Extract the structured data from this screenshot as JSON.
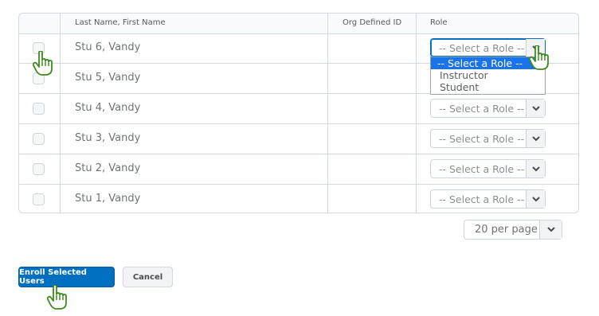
{
  "table": {
    "headers": {
      "name": "Last Name, First Name",
      "org_id": "Org Defined ID",
      "role": "Role"
    },
    "rows": [
      {
        "name": "Stu 6, Vandy",
        "org_id": "",
        "role": "-- Select a Role --"
      },
      {
        "name": "Stu 5, Vandy",
        "org_id": "",
        "role": "-- Select a Role --"
      },
      {
        "name": "Stu 4, Vandy",
        "org_id": "",
        "role": "-- Select a Role --"
      },
      {
        "name": "Stu 3, Vandy",
        "org_id": "",
        "role": "-- Select a Role --"
      },
      {
        "name": "Stu 2, Vandy",
        "org_id": "",
        "role": "-- Select a Role --"
      },
      {
        "name": "Stu 1, Vandy",
        "org_id": "",
        "role": "-- Select a Role --"
      }
    ]
  },
  "role_dropdown": {
    "options": [
      "-- Select a Role --",
      "Instructor",
      "Student"
    ],
    "highlighted": "-- Select a Role --"
  },
  "pager": {
    "label": "20 per page"
  },
  "actions": {
    "enroll_label": "Enroll Selected Users",
    "cancel_label": "Cancel"
  },
  "colors": {
    "primary": "#006fbf",
    "hand_pointer": "#3d8a1f",
    "dropdown_highlight": "#1a73e8"
  },
  "icons": {
    "pointer": "hand-pointer-icon",
    "chevron": "chevron-down-icon"
  }
}
